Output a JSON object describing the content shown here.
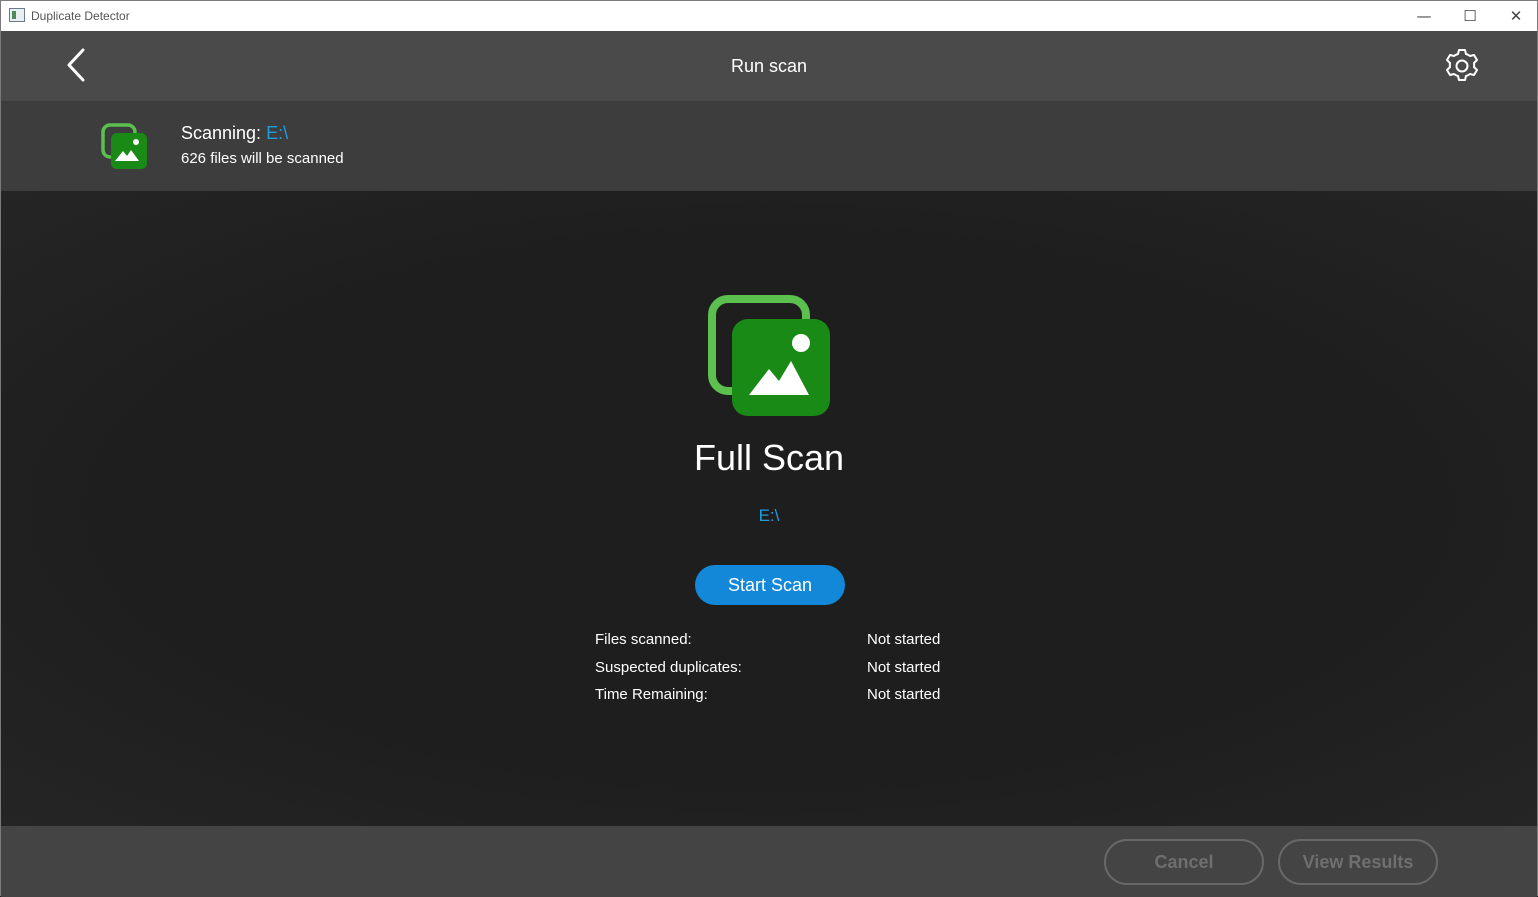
{
  "window": {
    "title": "Duplicate Detector",
    "minimize": "—",
    "maximize": "☐",
    "close": "✕"
  },
  "header": {
    "title": "Run scan"
  },
  "info": {
    "scanning_label": "Scanning: ",
    "scanning_path": "E:\\",
    "files_text": "626 files will be scanned"
  },
  "main": {
    "title": "Full Scan",
    "drive": "E:\\",
    "start_button": "Start Scan",
    "stats": [
      {
        "label": "Files scanned:",
        "value": "Not started"
      },
      {
        "label": "Suspected duplicates:",
        "value": "Not started"
      },
      {
        "label": "Time Remaining:",
        "value": "Not started"
      }
    ]
  },
  "footer": {
    "cancel": "Cancel",
    "view_results": "View Results"
  },
  "colors": {
    "accent": "#1488d8",
    "link": "#1e9ddf",
    "logo_green": "#1a8a16",
    "logo_light_green": "#5cc04f"
  },
  "icons": [
    "app-icon",
    "back-arrow-icon",
    "gear-icon",
    "duplicate-photo-icon"
  ]
}
